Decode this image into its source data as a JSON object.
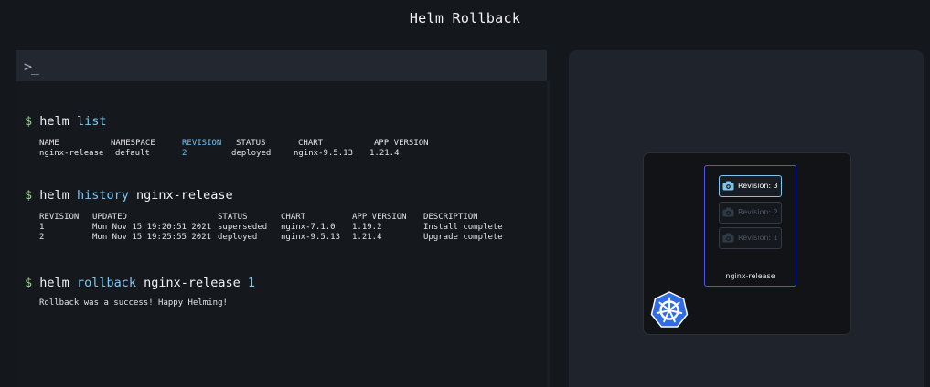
{
  "title": "Helm Rollback",
  "terminal": {
    "prompt_icon": ">_",
    "prompt_symbol": "$",
    "commands": [
      {
        "base": "helm",
        "arg": "list",
        "arg2": ""
      },
      {
        "base": "helm",
        "arg": "history",
        "arg2": "nginx-release"
      },
      {
        "base": "helm",
        "arg": "rollback",
        "arg2": "nginx-release",
        "arg3": "1"
      }
    ],
    "list_table": {
      "headers": [
        "NAME",
        "NAMESPACE",
        "REVISION",
        "STATUS",
        "CHART",
        "APP VERSION"
      ],
      "rows": [
        [
          "nginx-release",
          "default",
          "2",
          "deployed",
          "nginx-9.5.13",
          "1.21.4"
        ]
      ]
    },
    "history_table": {
      "headers": [
        "REVISION",
        "UPDATED",
        "STATUS",
        "CHART",
        "APP VERSION",
        "DESCRIPTION"
      ],
      "rows": [
        [
          "1",
          "Mon Nov 15 19:20:51 2021",
          "superseded",
          "nginx-7.1.0",
          "1.19.2",
          "Install complete"
        ],
        [
          "2",
          "Mon Nov 15 19:25:55 2021",
          "deployed",
          "nginx-9.5.13",
          "1.21.4",
          "Upgrade complete"
        ]
      ]
    },
    "rollback_output": "Rollback was a success! Happy Helming!"
  },
  "preview": {
    "release_name": "nginx-release",
    "revisions": [
      {
        "label": "Revision: 3",
        "active": true
      },
      {
        "label": "Revision: 2",
        "active": false
      },
      {
        "label": "Revision: 1",
        "active": false
      }
    ],
    "icons": {
      "revision": "camera-icon",
      "cluster": "kubernetes-logo-icon"
    },
    "colors": {
      "accent_blue": "#4b5be0",
      "active_border": "#7fc6ee",
      "k8s_blue": "#326ce5",
      "prompt_green": "#8fd47e",
      "highlight_cyan": "#7cc7f0"
    }
  }
}
